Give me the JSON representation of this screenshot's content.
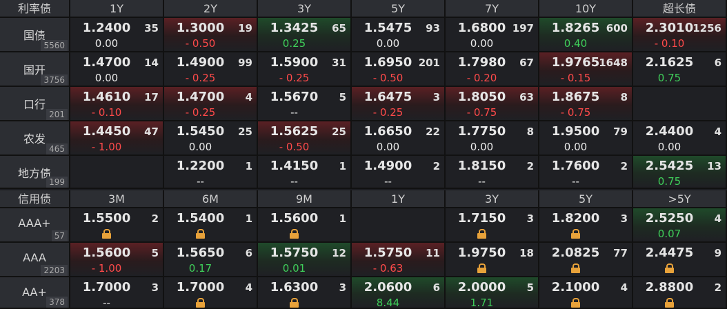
{
  "rate_section": {
    "title": "利率债",
    "columns": [
      "1Y",
      "2Y",
      "3Y",
      "5Y",
      "7Y",
      "10Y",
      "超长债"
    ],
    "rows": [
      {
        "name": "国债",
        "count": "5560",
        "cells": [
          {
            "yield": "1.2400",
            "vol": "35",
            "chg": "0.00",
            "dir": "flat",
            "bg": "none"
          },
          {
            "yield": "1.3000",
            "vol": "19",
            "chg": "- 0.50",
            "dir": "up",
            "bg": "red"
          },
          {
            "yield": "1.3425",
            "vol": "65",
            "chg": "0.25",
            "dir": "dn",
            "bg": "green"
          },
          {
            "yield": "1.5475",
            "vol": "93",
            "chg": "0.00",
            "dir": "flat",
            "bg": "none"
          },
          {
            "yield": "1.6800",
            "vol": "197",
            "chg": "0.00",
            "dir": "flat",
            "bg": "none"
          },
          {
            "yield": "1.8265",
            "vol": "600",
            "chg": "0.40",
            "dir": "dn",
            "bg": "green"
          },
          {
            "yield": "2.3010",
            "vol": "1256",
            "chg": "- 0.10",
            "dir": "up",
            "bg": "red"
          }
        ]
      },
      {
        "name": "国开",
        "count": "3756",
        "cells": [
          {
            "yield": "1.4700",
            "vol": "14",
            "chg": "0.00",
            "dir": "flat",
            "bg": "none"
          },
          {
            "yield": "1.4900",
            "vol": "99",
            "chg": "- 0.25",
            "dir": "up",
            "bg": "none"
          },
          {
            "yield": "1.5900",
            "vol": "31",
            "chg": "- 0.25",
            "dir": "up",
            "bg": "none"
          },
          {
            "yield": "1.6950",
            "vol": "201",
            "chg": "- 0.50",
            "dir": "up",
            "bg": "none"
          },
          {
            "yield": "1.7980",
            "vol": "67",
            "chg": "- 0.20",
            "dir": "up",
            "bg": "none"
          },
          {
            "yield": "1.9765",
            "vol": "1648",
            "chg": "- 0.15",
            "dir": "up",
            "bg": "red"
          },
          {
            "yield": "2.1625",
            "vol": "6",
            "chg": "0.75",
            "dir": "dn",
            "bg": "none"
          }
        ]
      },
      {
        "name": "口行",
        "count": "201",
        "cells": [
          {
            "yield": "1.4610",
            "vol": "17",
            "chg": "- 0.10",
            "dir": "up",
            "bg": "red"
          },
          {
            "yield": "1.4700",
            "vol": "4",
            "chg": "- 0.25",
            "dir": "up",
            "bg": "red"
          },
          {
            "yield": "1.5670",
            "vol": "5",
            "chg": "--",
            "dir": "flat",
            "bg": "none"
          },
          {
            "yield": "1.6475",
            "vol": "3",
            "chg": "- 0.25",
            "dir": "up",
            "bg": "red"
          },
          {
            "yield": "1.8050",
            "vol": "63",
            "chg": "- 0.75",
            "dir": "up",
            "bg": "red"
          },
          {
            "yield": "1.8675",
            "vol": "8",
            "chg": "- 0.75",
            "dir": "up",
            "bg": "red"
          },
          {
            "yield": "",
            "vol": "",
            "chg": "",
            "dir": "flat",
            "bg": "none"
          }
        ]
      },
      {
        "name": "农发",
        "count": "465",
        "cells": [
          {
            "yield": "1.4450",
            "vol": "47",
            "chg": "- 1.00",
            "dir": "up",
            "bg": "red"
          },
          {
            "yield": "1.5450",
            "vol": "25",
            "chg": "0.00",
            "dir": "flat",
            "bg": "none"
          },
          {
            "yield": "1.5625",
            "vol": "25",
            "chg": "- 0.50",
            "dir": "up",
            "bg": "red"
          },
          {
            "yield": "1.6650",
            "vol": "22",
            "chg": "0.00",
            "dir": "flat",
            "bg": "none"
          },
          {
            "yield": "1.7750",
            "vol": "8",
            "chg": "0.00",
            "dir": "flat",
            "bg": "none"
          },
          {
            "yield": "1.9500",
            "vol": "79",
            "chg": "0.00",
            "dir": "flat",
            "bg": "none"
          },
          {
            "yield": "2.4400",
            "vol": "4",
            "chg": "0.00",
            "dir": "flat",
            "bg": "none"
          }
        ]
      },
      {
        "name": "地方债",
        "count": "199",
        "cells": [
          {
            "yield": "",
            "vol": "",
            "chg": "",
            "dir": "flat",
            "bg": "none"
          },
          {
            "yield": "1.2200",
            "vol": "1",
            "chg": "--",
            "dir": "flat",
            "bg": "none"
          },
          {
            "yield": "1.4150",
            "vol": "1",
            "chg": "--",
            "dir": "flat",
            "bg": "none"
          },
          {
            "yield": "1.4900",
            "vol": "2",
            "chg": "--",
            "dir": "flat",
            "bg": "none"
          },
          {
            "yield": "1.8150",
            "vol": "2",
            "chg": "--",
            "dir": "flat",
            "bg": "none"
          },
          {
            "yield": "1.7600",
            "vol": "2",
            "chg": "--",
            "dir": "flat",
            "bg": "none"
          },
          {
            "yield": "2.5425",
            "vol": "13",
            "chg": "0.75",
            "dir": "dn",
            "bg": "green"
          }
        ]
      }
    ]
  },
  "credit_section": {
    "title": "信用债",
    "columns": [
      "3M",
      "6M",
      "9M",
      "1Y",
      "3Y",
      "5Y",
      ">5Y"
    ],
    "rows": [
      {
        "name": "AAA+",
        "count": "57",
        "cells": [
          {
            "yield": "1.5500",
            "vol": "2",
            "chg": "",
            "dir": "flat",
            "bg": "none",
            "lock": true
          },
          {
            "yield": "1.5400",
            "vol": "1",
            "chg": "",
            "dir": "flat",
            "bg": "none",
            "lock": true
          },
          {
            "yield": "1.5600",
            "vol": "1",
            "chg": "",
            "dir": "flat",
            "bg": "none",
            "lock": true
          },
          {
            "yield": "",
            "vol": "",
            "chg": "",
            "dir": "flat",
            "bg": "none"
          },
          {
            "yield": "1.7150",
            "vol": "3",
            "chg": "",
            "dir": "flat",
            "bg": "none",
            "lock": true
          },
          {
            "yield": "1.8200",
            "vol": "3",
            "chg": "",
            "dir": "flat",
            "bg": "none",
            "lock": true
          },
          {
            "yield": "2.5250",
            "vol": "4",
            "chg": "0.07",
            "dir": "dn",
            "bg": "green"
          }
        ]
      },
      {
        "name": "AAA",
        "count": "2203",
        "cells": [
          {
            "yield": "1.5600",
            "vol": "5",
            "chg": "- 1.00",
            "dir": "up",
            "bg": "red"
          },
          {
            "yield": "1.5650",
            "vol": "6",
            "chg": "0.17",
            "dir": "dn",
            "bg": "none"
          },
          {
            "yield": "1.5750",
            "vol": "12",
            "chg": "0.01",
            "dir": "dn",
            "bg": "green"
          },
          {
            "yield": "1.5750",
            "vol": "11",
            "chg": "- 0.63",
            "dir": "up",
            "bg": "red"
          },
          {
            "yield": "1.9750",
            "vol": "18",
            "chg": "",
            "dir": "flat",
            "bg": "none",
            "lock": true
          },
          {
            "yield": "2.0825",
            "vol": "77",
            "chg": "",
            "dir": "flat",
            "bg": "none",
            "lock": true
          },
          {
            "yield": "2.4475",
            "vol": "9",
            "chg": "",
            "dir": "flat",
            "bg": "none",
            "lock": true
          }
        ]
      },
      {
        "name": "AA+",
        "count": "378",
        "cells": [
          {
            "yield": "1.7000",
            "vol": "3",
            "chg": "--",
            "dir": "flat",
            "bg": "none"
          },
          {
            "yield": "1.7000",
            "vol": "4",
            "chg": "",
            "dir": "flat",
            "bg": "none",
            "lock": true
          },
          {
            "yield": "1.6300",
            "vol": "3",
            "chg": "",
            "dir": "flat",
            "bg": "none",
            "lock": true
          },
          {
            "yield": "2.0600",
            "vol": "6",
            "chg": "8.44",
            "dir": "dn",
            "bg": "green"
          },
          {
            "yield": "2.0000",
            "vol": "5",
            "chg": "1.71",
            "dir": "dn",
            "bg": "green"
          },
          {
            "yield": "2.1000",
            "vol": "4",
            "chg": "",
            "dir": "flat",
            "bg": "none",
            "lock": true
          },
          {
            "yield": "2.8800",
            "vol": "2",
            "chg": "",
            "dir": "flat",
            "bg": "none",
            "lock": true
          }
        ]
      }
    ]
  }
}
